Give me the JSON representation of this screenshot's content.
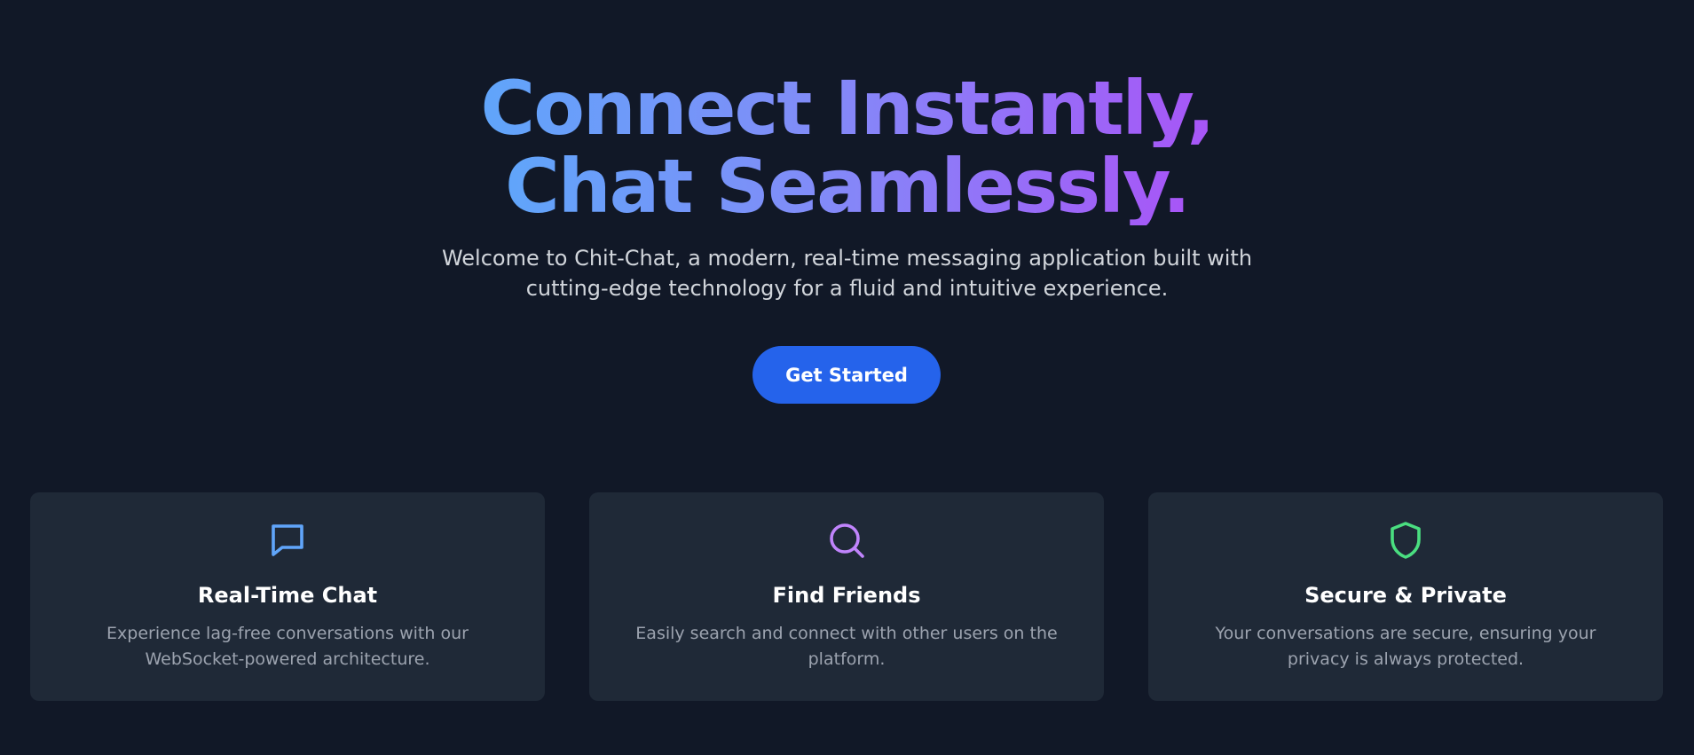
{
  "hero": {
    "title_line1": "Connect Instantly,",
    "title_line2": "Chat Seamlessly.",
    "subtitle": "Welcome to Chit-Chat, a modern, real-time messaging application built with cutting-edge technology for a fluid and intuitive experience.",
    "cta_label": "Get Started"
  },
  "colors": {
    "background": "#111827",
    "card_background": "#1f2937",
    "accent": "#2563eb",
    "gradient_start": "#60a5fa",
    "gradient_end": "#a855f7"
  },
  "features": [
    {
      "icon": "chat-bubble-icon",
      "icon_color": "#60a5fa",
      "title": "Real-Time Chat",
      "description": "Experience lag-free conversations with our WebSocket-powered architecture."
    },
    {
      "icon": "search-icon",
      "icon_color": "#c084fc",
      "title": "Find Friends",
      "description": "Easily search and connect with other users on the platform."
    },
    {
      "icon": "shield-icon",
      "icon_color": "#4ade80",
      "title": "Secure & Private",
      "description": "Your conversations are secure, ensuring your privacy is always protected."
    }
  ]
}
